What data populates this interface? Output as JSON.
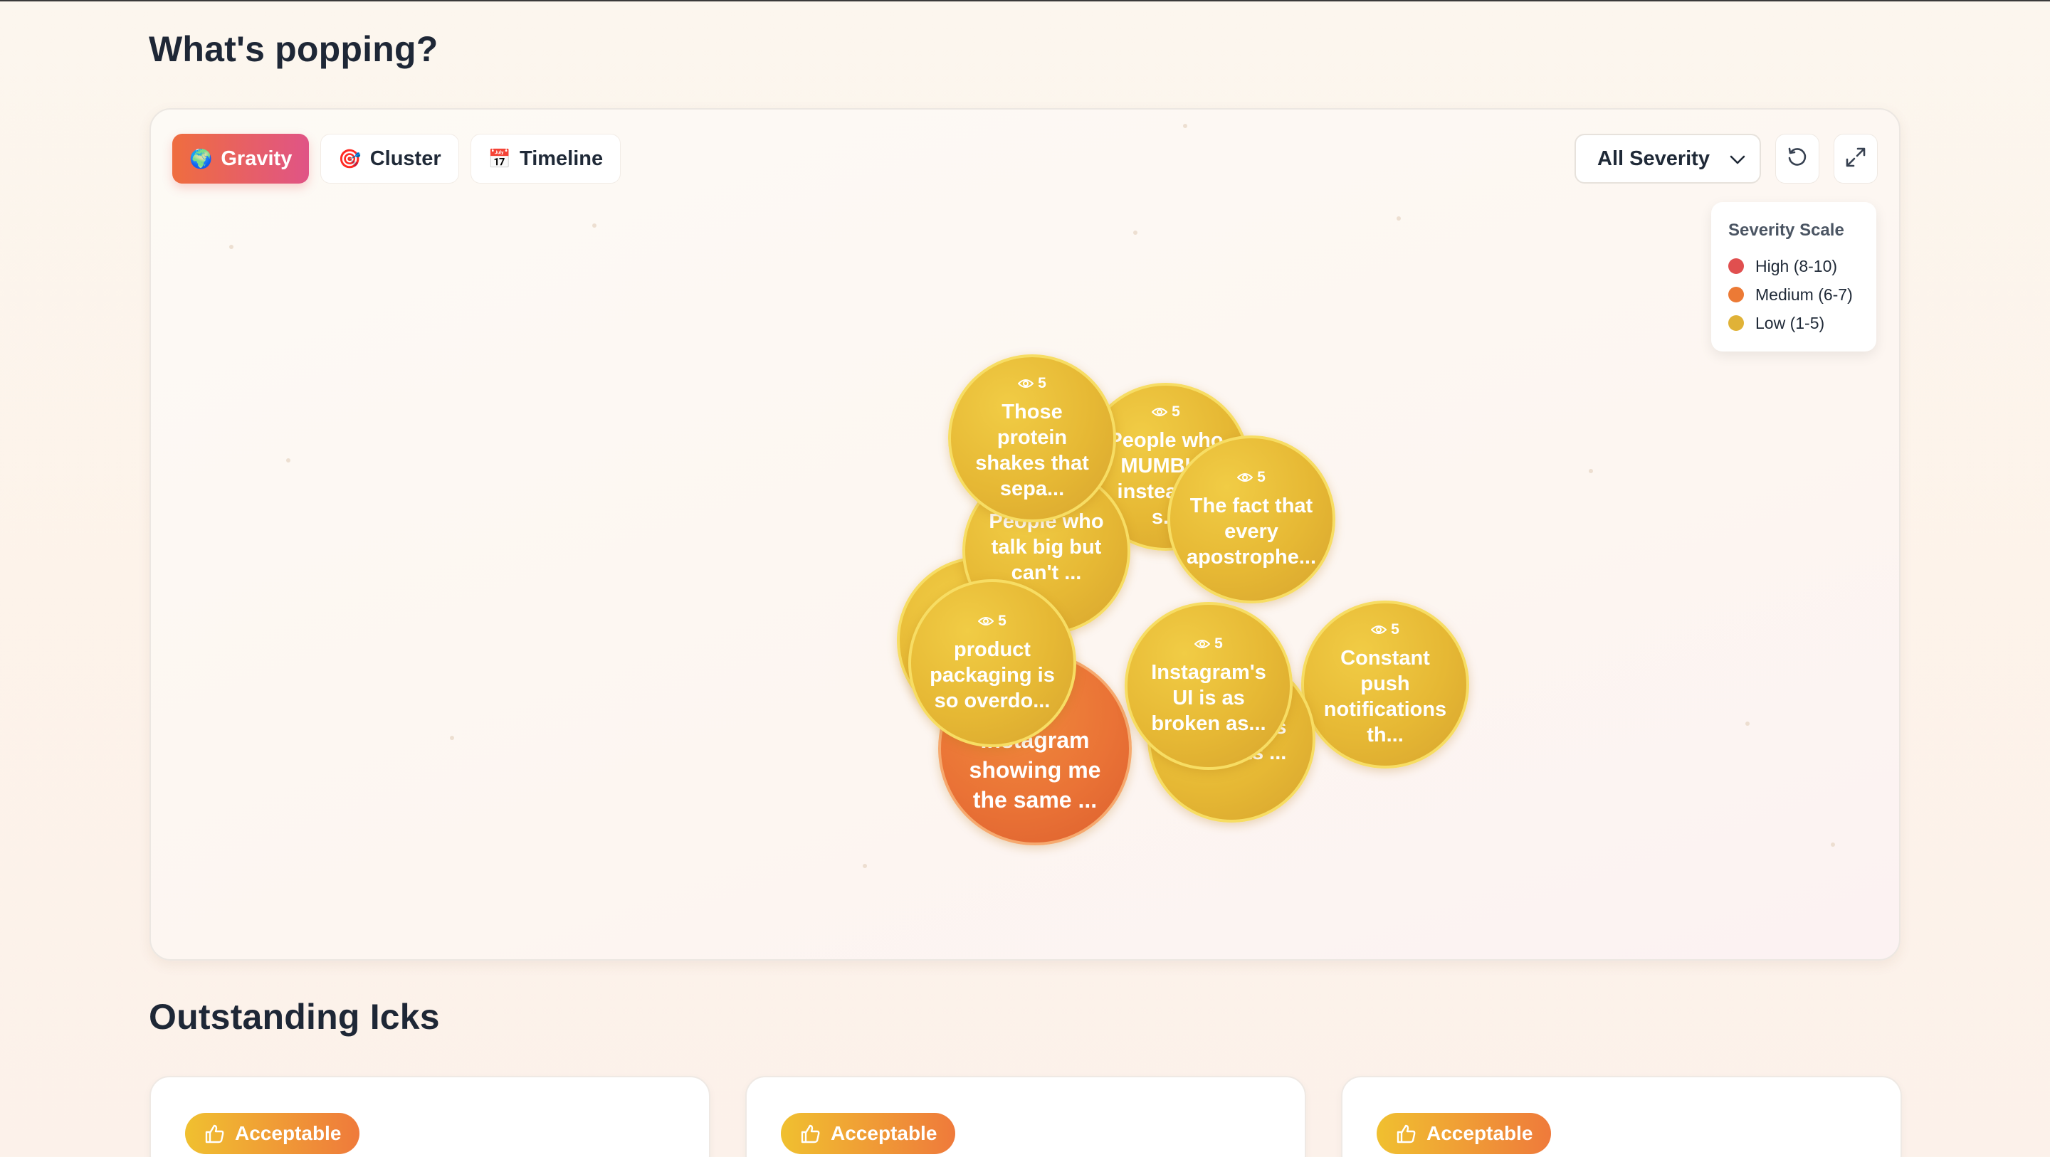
{
  "headings": {
    "popping": "What's popping?",
    "icks": "Outstanding Icks"
  },
  "tabs": [
    {
      "label": "Gravity",
      "icon": "globe-icon"
    },
    {
      "label": "Cluster",
      "icon": "target-icon"
    },
    {
      "label": "Timeline",
      "icon": "calendar-icon"
    }
  ],
  "active_tab": "Gravity",
  "filter": {
    "selected": "All Severity"
  },
  "legend": {
    "title": "Severity Scale",
    "items": [
      {
        "label": "High (8-10)",
        "color": "#e04f4f"
      },
      {
        "label": "Medium (6-7)",
        "color": "#ec7a35"
      },
      {
        "label": "Low (1-5)",
        "color": "#e0b237"
      }
    ]
  },
  "bubbles": [
    {
      "views": "",
      "text": "",
      "severity": "low"
    },
    {
      "views": "5",
      "text": "People who MUMBLE instead of s...",
      "severity": "low"
    },
    {
      "views": "",
      "text": "People who talk big but can't ...",
      "severity": "low"
    },
    {
      "views": "5",
      "text": "Those protein shakes that sepa...",
      "severity": "low"
    },
    {
      "views": "5",
      "text": "The fact that every apostrophe...",
      "severity": "low"
    },
    {
      "views": "5",
      "text": "Constant push notifications th...",
      "severity": "low"
    },
    {
      "views": "",
      "text": "Influencers or plants ...",
      "severity": "low"
    },
    {
      "views": "",
      "text": "Instagram showing me the same ...",
      "severity": "medium"
    },
    {
      "views": "5",
      "text": "product packaging is so overdo...",
      "severity": "low"
    },
    {
      "views": "5",
      "text": "Instagram's UI is as broken as...",
      "severity": "low"
    }
  ],
  "cards": [
    {
      "badge": "Acceptable"
    },
    {
      "badge": "Acceptable"
    },
    {
      "badge": "Acceptable"
    }
  ]
}
